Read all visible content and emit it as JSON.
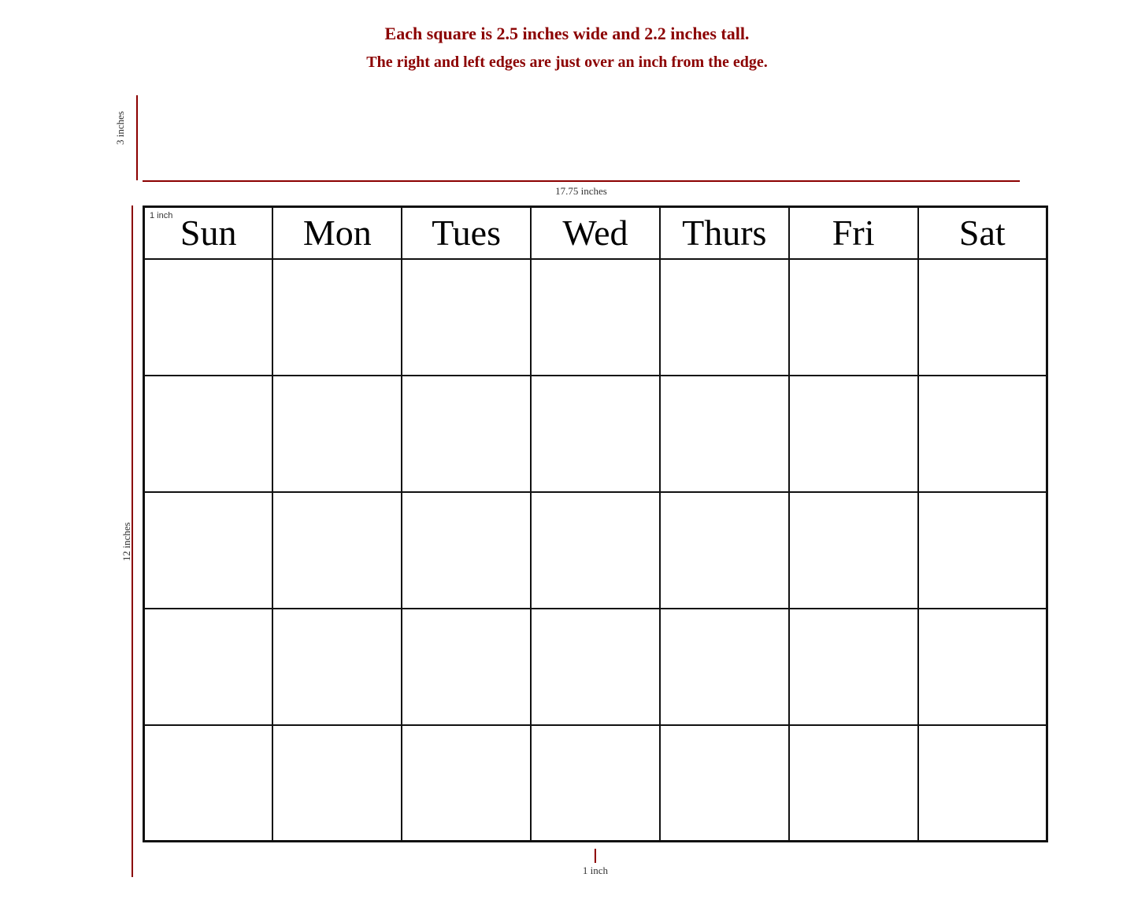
{
  "description": {
    "line1": "Each square is 2.5 inches wide and 2.2 inches tall.",
    "line2": "The right and left edges are just over an inch from the edge."
  },
  "measurements": {
    "top_vertical": "3 inches",
    "horizontal": "17.75 inches",
    "left_vertical": "12 inches",
    "corner_label": "1 inch",
    "bottom_label": "1 inch"
  },
  "calendar": {
    "days": [
      "Sun",
      "Mon",
      "Tues",
      "Wed",
      "Thurs",
      "Fri",
      "Sat"
    ],
    "rows": 5
  }
}
